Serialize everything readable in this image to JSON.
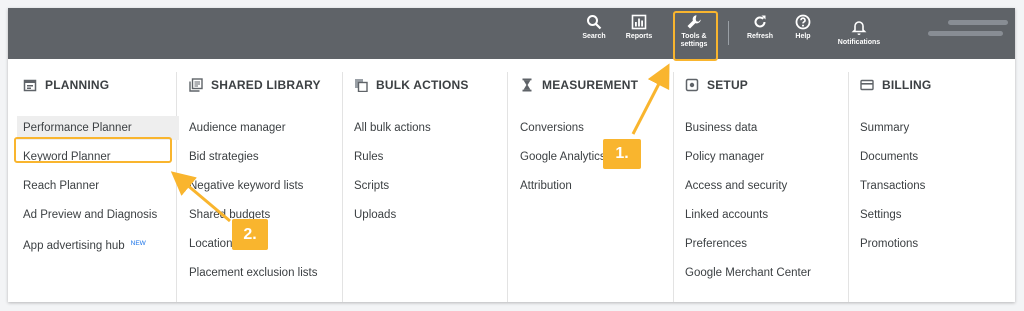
{
  "topbar": {
    "search": {
      "label": "Search",
      "icon": "search-icon"
    },
    "reports": {
      "label": "Reports",
      "icon": "bar-chart-icon"
    },
    "tools": {
      "label_line1": "Tools &",
      "label_line2": "settings",
      "icon": "wrench-icon"
    },
    "refresh": {
      "label": "Refresh",
      "icon": "refresh-icon"
    },
    "help": {
      "label": "Help",
      "icon": "help-icon"
    },
    "notifications": {
      "label": "Notifications",
      "icon": "bell-icon"
    }
  },
  "columns": [
    {
      "header": "PLANNING",
      "icon": "calendar-icon",
      "items": [
        "Performance Planner",
        "Keyword Planner",
        "Reach Planner",
        "Ad Preview and Diagnosis",
        "App advertising hub"
      ]
    },
    {
      "header": "SHARED LIBRARY",
      "icon": "library-icon",
      "items": [
        "Audience manager",
        "Bid strategies",
        "Negative keyword lists",
        "Shared budgets",
        "Location",
        "Placement exclusion lists"
      ]
    },
    {
      "header": "BULK ACTIONS",
      "icon": "copy-icon",
      "items": [
        "All bulk actions",
        "Rules",
        "Scripts",
        "Uploads"
      ]
    },
    {
      "header": "MEASUREMENT",
      "icon": "hourglass-icon",
      "items": [
        "Conversions",
        "Google Analytics",
        "Attribution"
      ]
    },
    {
      "header": "SETUP",
      "icon": "settings-box-icon",
      "items": [
        "Business data",
        "Policy manager",
        "Access and security",
        "Linked accounts",
        "Preferences",
        "Google Merchant Center"
      ]
    },
    {
      "header": "BILLING",
      "icon": "credit-card-icon",
      "items": [
        "Summary",
        "Documents",
        "Transactions",
        "Settings",
        "Promotions"
      ]
    }
  ],
  "badges": {
    "new": "NEW"
  },
  "annotations": {
    "step1": "1.",
    "step2": "2."
  },
  "colors": {
    "accent": "#f9b52e",
    "topbar": "#5f6368",
    "link_blue": "#1a73e8"
  }
}
